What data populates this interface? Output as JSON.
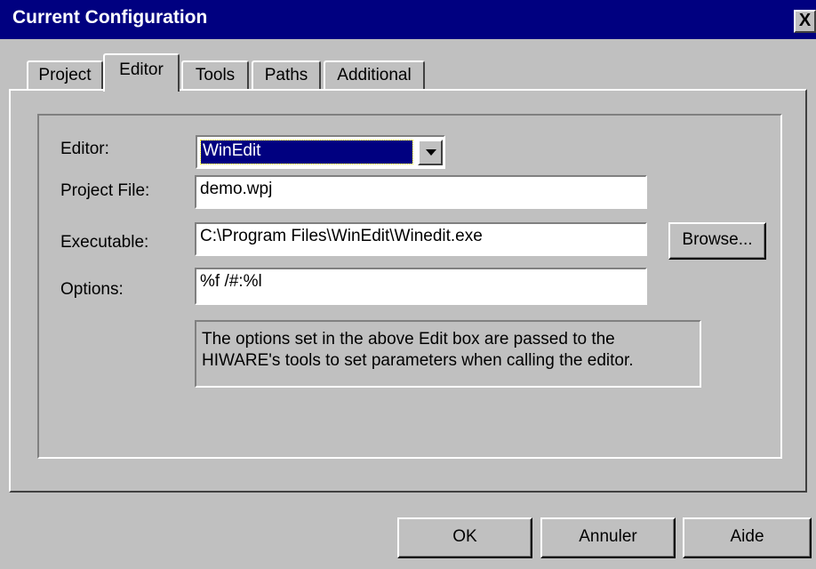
{
  "window": {
    "title": "Current Configuration",
    "close_glyph": "X"
  },
  "tabs": [
    {
      "label": "Project",
      "active": false
    },
    {
      "label": "Editor",
      "active": true
    },
    {
      "label": "Tools",
      "active": false
    },
    {
      "label": "Paths",
      "active": false
    },
    {
      "label": "Additional",
      "active": false
    }
  ],
  "form": {
    "editor_label": "Editor:",
    "editor_value": "WinEdit",
    "project_file_label": "Project File:",
    "project_file_value": "demo.wpj",
    "executable_label": "Executable:",
    "executable_value": "C:\\Program Files\\WinEdit\\Winedit.exe",
    "browse_label": "Browse...",
    "options_label": "Options:",
    "options_value": "%f /#:%l",
    "info_line1": "The options set in the above Edit box are passed to the",
    "info_line2": "HIWARE's tools to set parameters when calling the editor."
  },
  "buttons": {
    "ok": "OK",
    "cancel": "Annuler",
    "help": "Aide"
  }
}
